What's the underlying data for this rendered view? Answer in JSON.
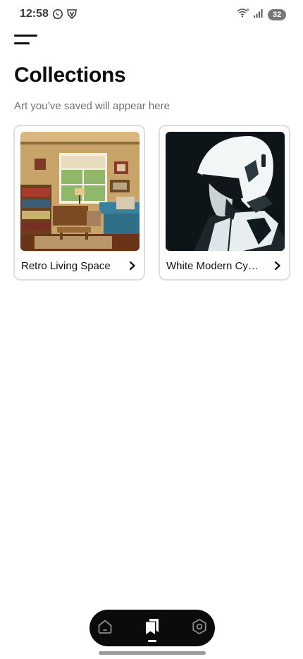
{
  "status_bar": {
    "time": "12:58",
    "notification_icons": [
      "whatsapp-icon",
      "vpn-shield-icon"
    ],
    "system_icons": [
      "wifi-6-icon",
      "signal-icon"
    ],
    "battery_level": "32"
  },
  "header": {
    "menu_icon": "hamburger-menu-icon",
    "title": "Collections",
    "subtitle": "Art you’ve saved will appear here"
  },
  "collections": [
    {
      "name": "Retro Living Space",
      "image": "retro-living-room-artwork"
    },
    {
      "name": "White Modern Cy…",
      "image": "white-robot-helmet-artwork"
    }
  ],
  "bottom_nav": {
    "items": [
      {
        "icon": "home-icon",
        "active": false
      },
      {
        "icon": "collections-icon",
        "active": true
      },
      {
        "icon": "settings-hexagon-icon",
        "active": false
      }
    ]
  },
  "colors": {
    "background": "#ffffff",
    "text_primary": "#111111",
    "text_secondary": "#707070",
    "card_border": "#dedede",
    "nav_background": "#0b0b0b"
  }
}
